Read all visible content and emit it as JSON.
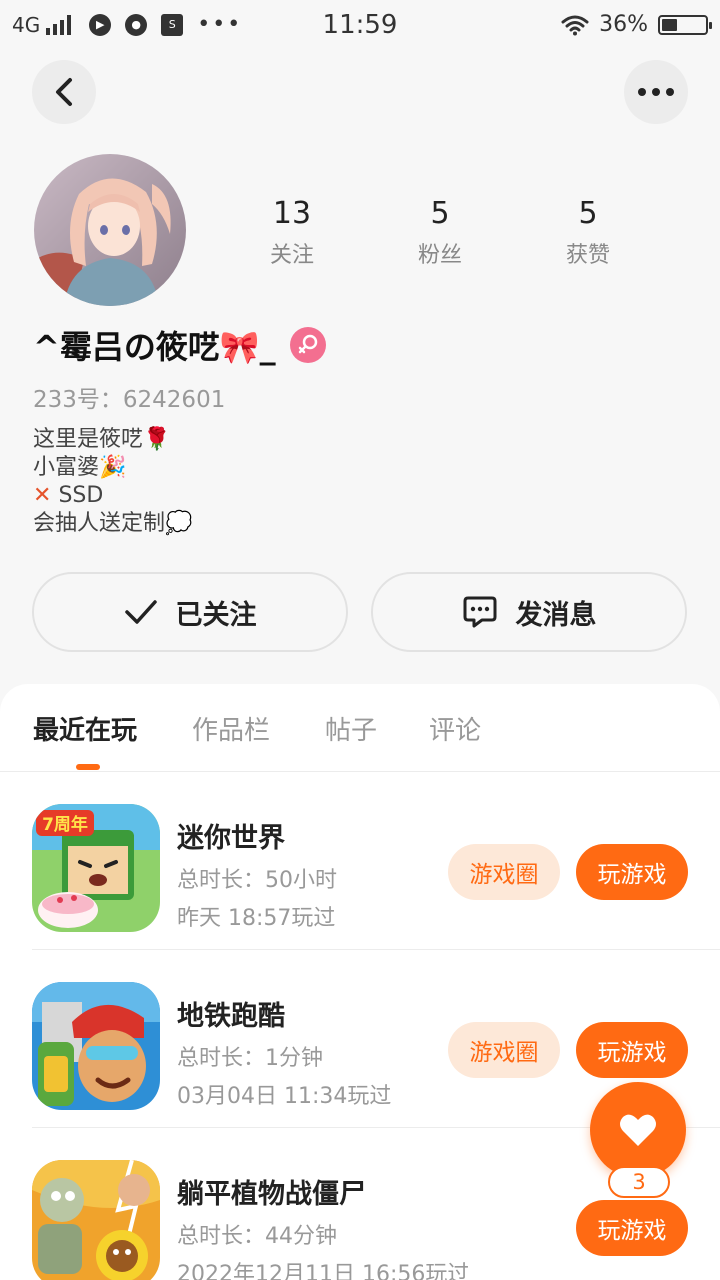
{
  "status_bar": {
    "network": "4G",
    "time": "11:59",
    "battery_percent": "36%",
    "battery_level": 0.36,
    "overflow": "•••"
  },
  "profile": {
    "stats": [
      {
        "value": "13",
        "label": "关注"
      },
      {
        "value": "5",
        "label": "粉丝"
      },
      {
        "value": "5",
        "label": "获赞"
      }
    ],
    "username": "^霉吕の筱呓🎀_",
    "uid": "233号：6242601",
    "bio": [
      "这里是筱呓🌹",
      "小富婆🎉",
      "SSD",
      "会抽人送定制💭"
    ],
    "bio_x_mark": "✕"
  },
  "actions": {
    "follow_label": "已关注",
    "message_label": "发消息"
  },
  "tabs": [
    "最近在玩",
    "作品栏",
    "帖子",
    "评论"
  ],
  "games": [
    {
      "name": "迷你世界",
      "duration": "总时长：50小时",
      "last_played": "昨天 18:57玩过",
      "circle_label": "游戏圈",
      "play_label": "玩游戏",
      "badge": "7周年"
    },
    {
      "name": "地铁跑酷",
      "duration": "总时长：1分钟",
      "last_played": "03月04日 11:34玩过",
      "circle_label": "游戏圈",
      "play_label": "玩游戏"
    },
    {
      "name": "躺平植物战僵尸",
      "duration": "总时长：44分钟",
      "last_played": "2022年12月11日 16:56玩过",
      "play_label": "玩游戏"
    }
  ],
  "fab": {
    "count": "3"
  },
  "colors": {
    "accent": "#ff6a13",
    "accent_light": "#fde8d8",
    "gender": "#f36f90"
  },
  "icons": [
    "back-icon",
    "more-icon",
    "check-icon",
    "chat-icon",
    "female-icon",
    "heart-icon",
    "wifi-icon",
    "battery-icon"
  ]
}
